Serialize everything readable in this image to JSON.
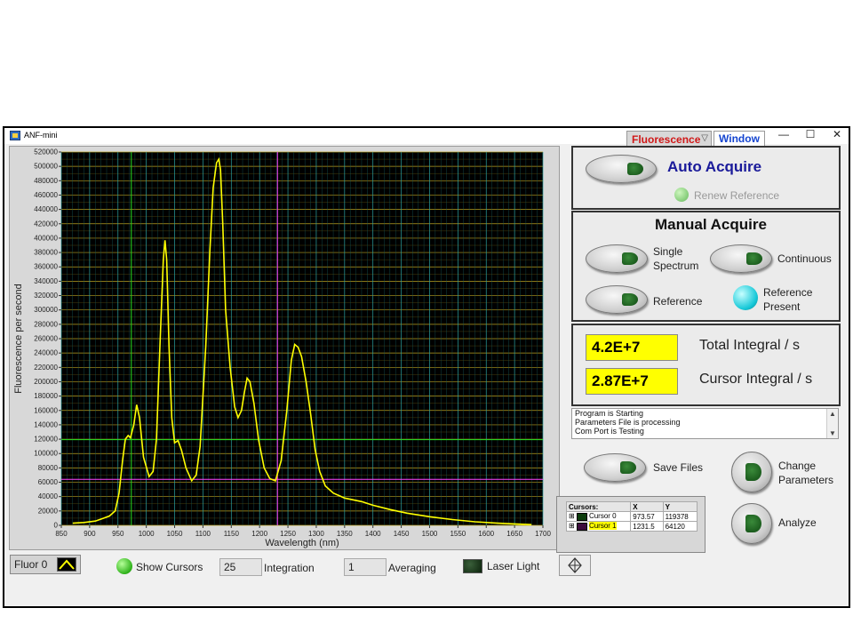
{
  "window": {
    "title": "ANF-mini",
    "menu_select": "Fluorescence",
    "menu_window": "Window",
    "controls": {
      "minimize": "—",
      "maximize": "☐",
      "close": "✕"
    }
  },
  "graph": {
    "plot_bg": "#000000",
    "trace_color": "#ffff00",
    "cursor0_color": "#22dd22",
    "cursor1_color": "#ff44ff",
    "legend_label": "Fluor 0"
  },
  "chart_data": {
    "type": "line",
    "xlabel": "Wavelength (nm)",
    "ylabel": "Fluorescence per second",
    "xlim": [
      850,
      1700
    ],
    "ylim": [
      0,
      520000
    ],
    "x_ticks": [
      850,
      900,
      950,
      1000,
      1050,
      1100,
      1150,
      1200,
      1250,
      1300,
      1350,
      1400,
      1450,
      1500,
      1550,
      1600,
      1650,
      1700
    ],
    "y_ticks": [
      0,
      20000,
      40000,
      60000,
      80000,
      100000,
      120000,
      140000,
      160000,
      180000,
      200000,
      220000,
      240000,
      260000,
      280000,
      300000,
      320000,
      340000,
      360000,
      380000,
      400000,
      420000,
      440000,
      460000,
      480000,
      500000,
      520000
    ],
    "series": [
      {
        "x": [
          870,
          890,
          910,
          925,
          935,
          945,
          952,
          958,
          963,
          968,
          972,
          978,
          983,
          988,
          995,
          1005,
          1012,
          1018,
          1024,
          1030,
          1033,
          1036,
          1040,
          1045,
          1050,
          1056,
          1062,
          1070,
          1080,
          1088,
          1095,
          1105,
          1112,
          1118,
          1124,
          1128,
          1131,
          1135,
          1140,
          1148,
          1156,
          1162,
          1168,
          1173,
          1178,
          1183,
          1190,
          1198,
          1208,
          1218,
          1228,
          1238,
          1248,
          1256,
          1262,
          1268,
          1274,
          1282,
          1290,
          1298,
          1306,
          1316,
          1330,
          1350,
          1380,
          1400,
          1430,
          1460,
          1500,
          1540,
          1580,
          1620,
          1650,
          1680
        ],
        "y": [
          3000,
          4000,
          6000,
          10000,
          13000,
          20000,
          45000,
          90000,
          120000,
          125000,
          122000,
          140000,
          168000,
          150000,
          95000,
          68000,
          75000,
          120000,
          250000,
          370000,
          397000,
          370000,
          250000,
          150000,
          115000,
          118000,
          105000,
          80000,
          62000,
          70000,
          110000,
          250000,
          380000,
          470000,
          505000,
          510000,
          495000,
          420000,
          300000,
          220000,
          165000,
          150000,
          160000,
          185000,
          205000,
          200000,
          170000,
          120000,
          80000,
          65000,
          62000,
          90000,
          160000,
          230000,
          252000,
          248000,
          235000,
          200000,
          155000,
          105000,
          75000,
          55000,
          45000,
          38000,
          33000,
          28000,
          22000,
          17000,
          12000,
          8000,
          5000,
          3000,
          2000,
          1000
        ]
      }
    ],
    "cursors": [
      {
        "name": "Cursor 0",
        "x": 973.57,
        "y": 119378
      },
      {
        "name": "Cursor 1",
        "x": 1231.5,
        "y": 64120
      }
    ]
  },
  "auto_acquire": {
    "label": "Auto Acquire",
    "renew_reference": "Renew Reference"
  },
  "manual_acquire": {
    "title": "Manual Acquire",
    "single_spectrum_1": "Single",
    "single_spectrum_2": "Spectrum",
    "continuous": "Continuous",
    "reference": "Reference",
    "reference_present_1": "Reference",
    "reference_present_2": "Present"
  },
  "integrals": {
    "total_value": "4.2E+7",
    "total_label": "Total Integral / s",
    "cursor_value": "2.87E+7",
    "cursor_label": "Cursor Integral / s"
  },
  "log": {
    "lines": [
      "Program is Starting",
      "Parameters File is processing",
      "Com Port is Testing"
    ]
  },
  "actions": {
    "save_files": "Save Files",
    "change_parameters_1": "Change",
    "change_parameters_2": "Parameters",
    "analyze": "Analyze"
  },
  "cursor_table": {
    "headers": [
      "Cursors:",
      "X",
      "Y"
    ],
    "rows": [
      {
        "name": "Cursor 0",
        "x": "973.57",
        "y": "119378"
      },
      {
        "name": "Cursor 1",
        "x": "1231.5",
        "y": "64120"
      }
    ]
  },
  "bottom": {
    "show_cursors": "Show Cursors",
    "integration_value": "25",
    "integration_label": "Integration",
    "averaging_value": "1",
    "averaging_label": "Averaging",
    "laser_light": "Laser Light"
  }
}
